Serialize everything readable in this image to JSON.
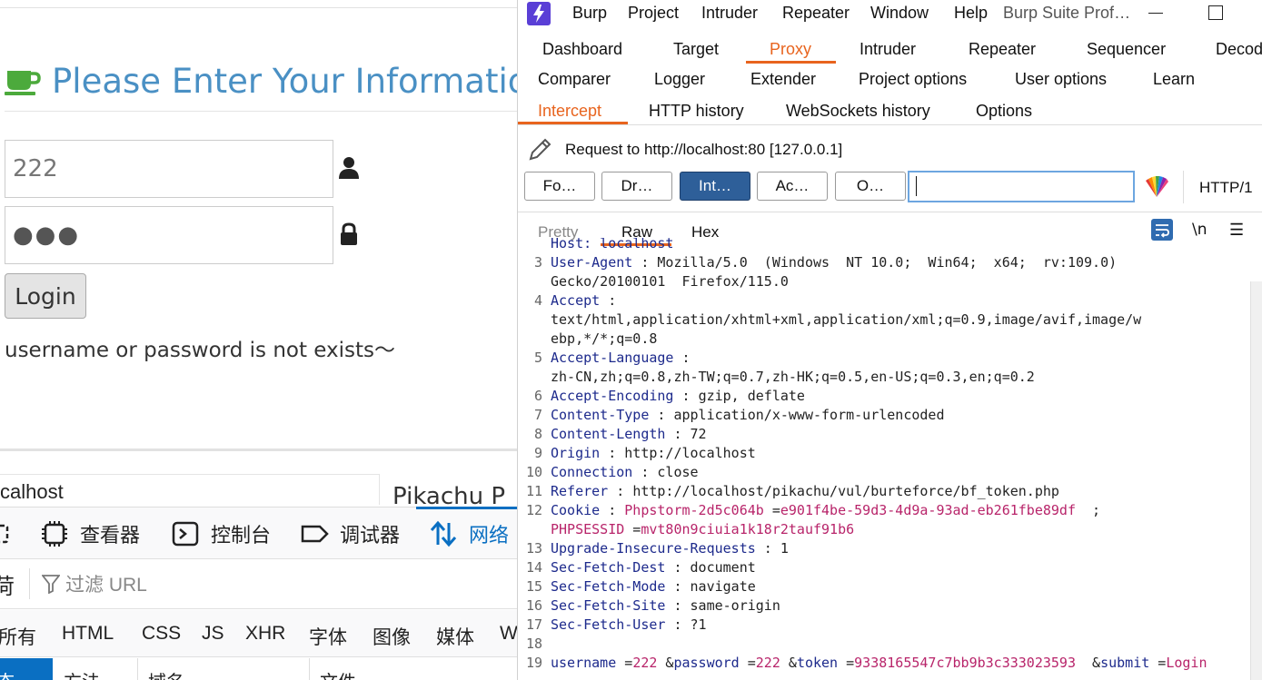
{
  "browser": {
    "page_title": "Please Enter Your Information",
    "username_value": "222",
    "password_value": "●●●",
    "login_label": "Login",
    "message": "username or password is not exists～",
    "devtools": {
      "host": "calhost",
      "page_label": "Pikachu P",
      "tabs": [
        "查看器",
        "控制台",
        "调试器",
        "网络"
      ],
      "filter_placeholder": "过滤 URL",
      "filter_left_glyph": "荷",
      "type_tabs": [
        "所有",
        "HTML",
        "CSS",
        "JS",
        "XHR",
        "字体",
        "图像",
        "媒体",
        "W"
      ],
      "columns": [
        "方法",
        "域名",
        "文件"
      ],
      "selected_col": "态"
    }
  },
  "burp": {
    "menu": [
      "Burp",
      "Project",
      "Intruder",
      "Repeater",
      "Window",
      "Help"
    ],
    "window_title": "Burp Suite Prof…",
    "main_tabs_row1": [
      "Dashboard",
      "Target",
      "Proxy",
      "Intruder",
      "Repeater",
      "Sequencer",
      "Decod"
    ],
    "main_tabs_row2": [
      "Comparer",
      "Logger",
      "Extender",
      "Project options",
      "User options",
      "Learn"
    ],
    "sub_tabs": [
      "Intercept",
      "HTTP history",
      "WebSockets history",
      "Options"
    ],
    "request_to": "Request to http://localhost:80  [127.0.0.1]",
    "buttons": [
      "Fo…",
      "Dr…",
      "Int…",
      "Ac…",
      "O…"
    ],
    "http_version": "HTTP/1",
    "view_tabs": [
      "Pretty",
      "Raw",
      "Hex"
    ],
    "newline_label": "\\n",
    "menu_glyph": "☰",
    "lines": [
      {
        "n": "",
        "text": "Host: localhost"
      },
      {
        "n": "3",
        "k": "User-Agent",
        "v": "Mozilla/5.0  (Windows  NT 10.0;  Win64;  x64;  rv:109.0)"
      },
      {
        "n": "",
        "cont": "Gecko/20100101  Firefox/115.0"
      },
      {
        "n": "4",
        "k": "Accept",
        "v": ""
      },
      {
        "n": "",
        "cont": "text/html,application/xhtml+xml,application/xml;q=0.9,image/avif,image/w"
      },
      {
        "n": "",
        "cont": "ebp,*/*;q=0.8"
      },
      {
        "n": "5",
        "k": "Accept-Language",
        "v": ""
      },
      {
        "n": "",
        "cont": "zh-CN,zh;q=0.8,zh-TW;q=0.7,zh-HK;q=0.5,en-US;q=0.3,en;q=0.2"
      },
      {
        "n": "6",
        "k": "Accept-Encoding",
        "v": "gzip, deflate"
      },
      {
        "n": "7",
        "k": "Content-Type",
        "v": "application/x-www-form-urlencoded"
      },
      {
        "n": "8",
        "k": "Content-Length",
        "v": "72"
      },
      {
        "n": "9",
        "k": "Origin",
        "v": "http://localhost"
      },
      {
        "n": "10",
        "k": "Connection",
        "v": "close"
      },
      {
        "n": "11",
        "k": "Referer",
        "v": "http://localhost/pikachu/vul/burteforce/bf_token.php"
      },
      {
        "n": "12",
        "k": "Cookie",
        "ck": "Phpstorm-2d5c064b",
        "cv": "e901f4be-59d3-4d9a-93ad-eb261fbe89df",
        "tail": " ;"
      },
      {
        "n": "",
        "ck": "PHPSESSID",
        "cv": "mvt80n9ciuia1k18r2tauf91b6"
      },
      {
        "n": "13",
        "k": "Upgrade-Insecure-Requests",
        "v": "1"
      },
      {
        "n": "14",
        "k": "Sec-Fetch-Dest",
        "v": "document"
      },
      {
        "n": "15",
        "k": "Sec-Fetch-Mode",
        "v": "navigate"
      },
      {
        "n": "16",
        "k": "Sec-Fetch-Site",
        "v": "same-origin"
      },
      {
        "n": "17",
        "k": "Sec-Fetch-User",
        "v": "?1"
      },
      {
        "n": "18",
        "text": ""
      },
      {
        "n": "19",
        "params": [
          [
            "username",
            "222"
          ],
          [
            "password",
            "222"
          ],
          [
            "token",
            "9338165547c7bb9b3c333023593 "
          ],
          [
            "submit",
            "Login"
          ]
        ]
      }
    ]
  },
  "colors": {
    "accent_orange": "#e8641e",
    "title_blue": "#4a90c4",
    "header_key": "#1d2a8c",
    "cookie_pink": "#b8246a",
    "button_blue": "#2e5f99",
    "devtools_blue": "#0a6fc2"
  }
}
